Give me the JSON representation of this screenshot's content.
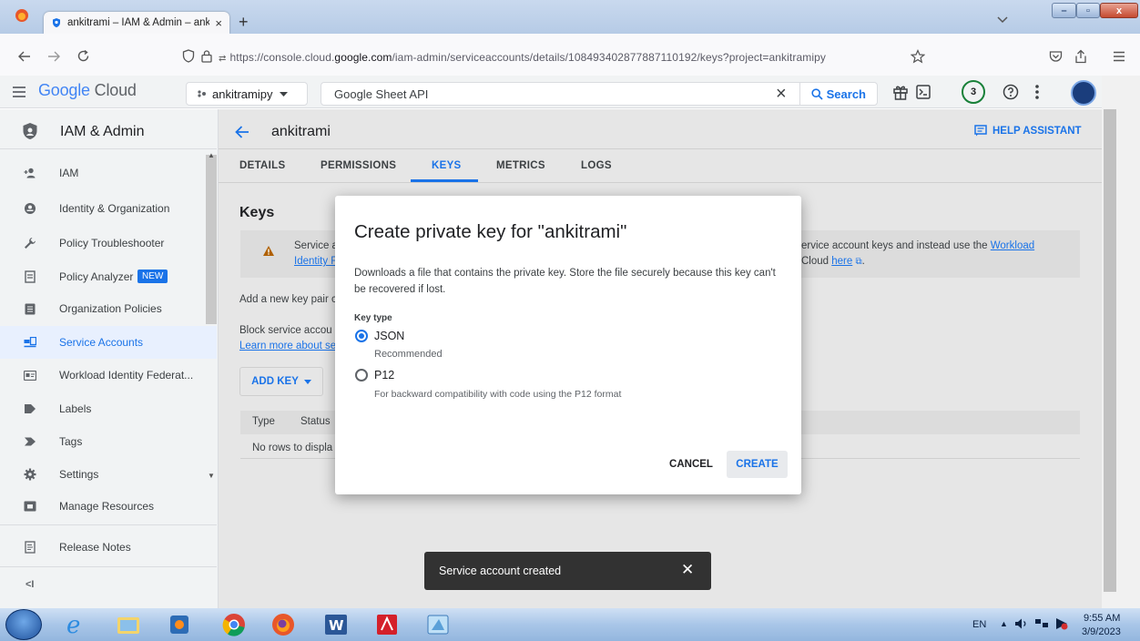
{
  "browser": {
    "tab_title": "ankitrami – IAM & Admin – ank",
    "tab_close": "×",
    "new_tab": "+",
    "url_prefix": "https://console.cloud.",
    "url_domain": "google.com",
    "url_suffix": "/iam-admin/serviceaccounts/details/108493402877887110192/keys?project=ankitramipy",
    "win_minimize": "–",
    "win_restore": "▫",
    "win_close": "x"
  },
  "gc_header": {
    "brand_google": "Google",
    "brand_cloud": "Cloud",
    "project": "ankitramipy",
    "search_value": "Google Sheet API",
    "search_clear": "×",
    "search_label": "Search",
    "notification_count": "3"
  },
  "sidebar": {
    "title": "IAM & Admin",
    "items": [
      {
        "label": "IAM",
        "icon": "person-add-icon"
      },
      {
        "label": "Identity & Organization",
        "icon": "account-circle-icon"
      },
      {
        "label": "Policy Troubleshooter",
        "icon": "wrench-icon"
      },
      {
        "label": "Policy Analyzer",
        "icon": "report-icon",
        "badge": "NEW"
      },
      {
        "label": "Organization Policies",
        "icon": "list-icon"
      },
      {
        "label": "Service Accounts",
        "icon": "service-account-icon",
        "active": true
      },
      {
        "label": "Workload Identity Federat...",
        "icon": "id-card-icon"
      },
      {
        "label": "Labels",
        "icon": "label-icon"
      },
      {
        "label": "Tags",
        "icon": "tag-icon"
      },
      {
        "label": "Settings",
        "icon": "gear-icon"
      },
      {
        "label": "Manage Resources",
        "icon": "folder-icon"
      },
      {
        "label": "Release Notes",
        "icon": "notes-icon"
      }
    ],
    "collapse": "<I"
  },
  "main": {
    "page_title": "ankitrami",
    "help_assistant": "HELP ASSISTANT",
    "tabs": [
      {
        "label": "DETAILS"
      },
      {
        "label": "PERMISSIONS"
      },
      {
        "label": "KEYS",
        "active": true
      },
      {
        "label": "METRICS"
      },
      {
        "label": "LOGS"
      }
    ],
    "section_title": "Keys",
    "warning_left_1": "Service a",
    "warning_left_2": "Identity F",
    "warning_right_1": "ervice account keys and instead use the ",
    "warning_right_link": "Workload",
    "warning_right_2": "Cloud ",
    "warning_right_here": "here",
    "add_key_text": "Add a new key pair c",
    "block_text": "Block service accou",
    "learn_more": "Learn more about se",
    "add_key_button": "ADD KEY",
    "table_headers": [
      "Type",
      "Status"
    ],
    "empty_text": "No rows to displa"
  },
  "dialog": {
    "title": "Create private key for \"ankitrami\"",
    "description": "Downloads a file that contains the private key. Store the file securely because this key can't be recovered if lost.",
    "key_type_label": "Key type",
    "options": [
      {
        "label": "JSON",
        "hint": "Recommended",
        "selected": true
      },
      {
        "label": "P12",
        "hint": "For backward compatibility with code using the P12 format",
        "selected": false
      }
    ],
    "cancel": "CANCEL",
    "create": "CREATE"
  },
  "snackbar": {
    "message": "Service account created",
    "close": "✕"
  },
  "taskbar": {
    "lang": "EN",
    "time": "9:55 AM",
    "date": "3/9/2023"
  },
  "colors": {
    "accent": "#1a73e8",
    "new_badge": "#1a73e8",
    "snackbar": "#323232"
  }
}
